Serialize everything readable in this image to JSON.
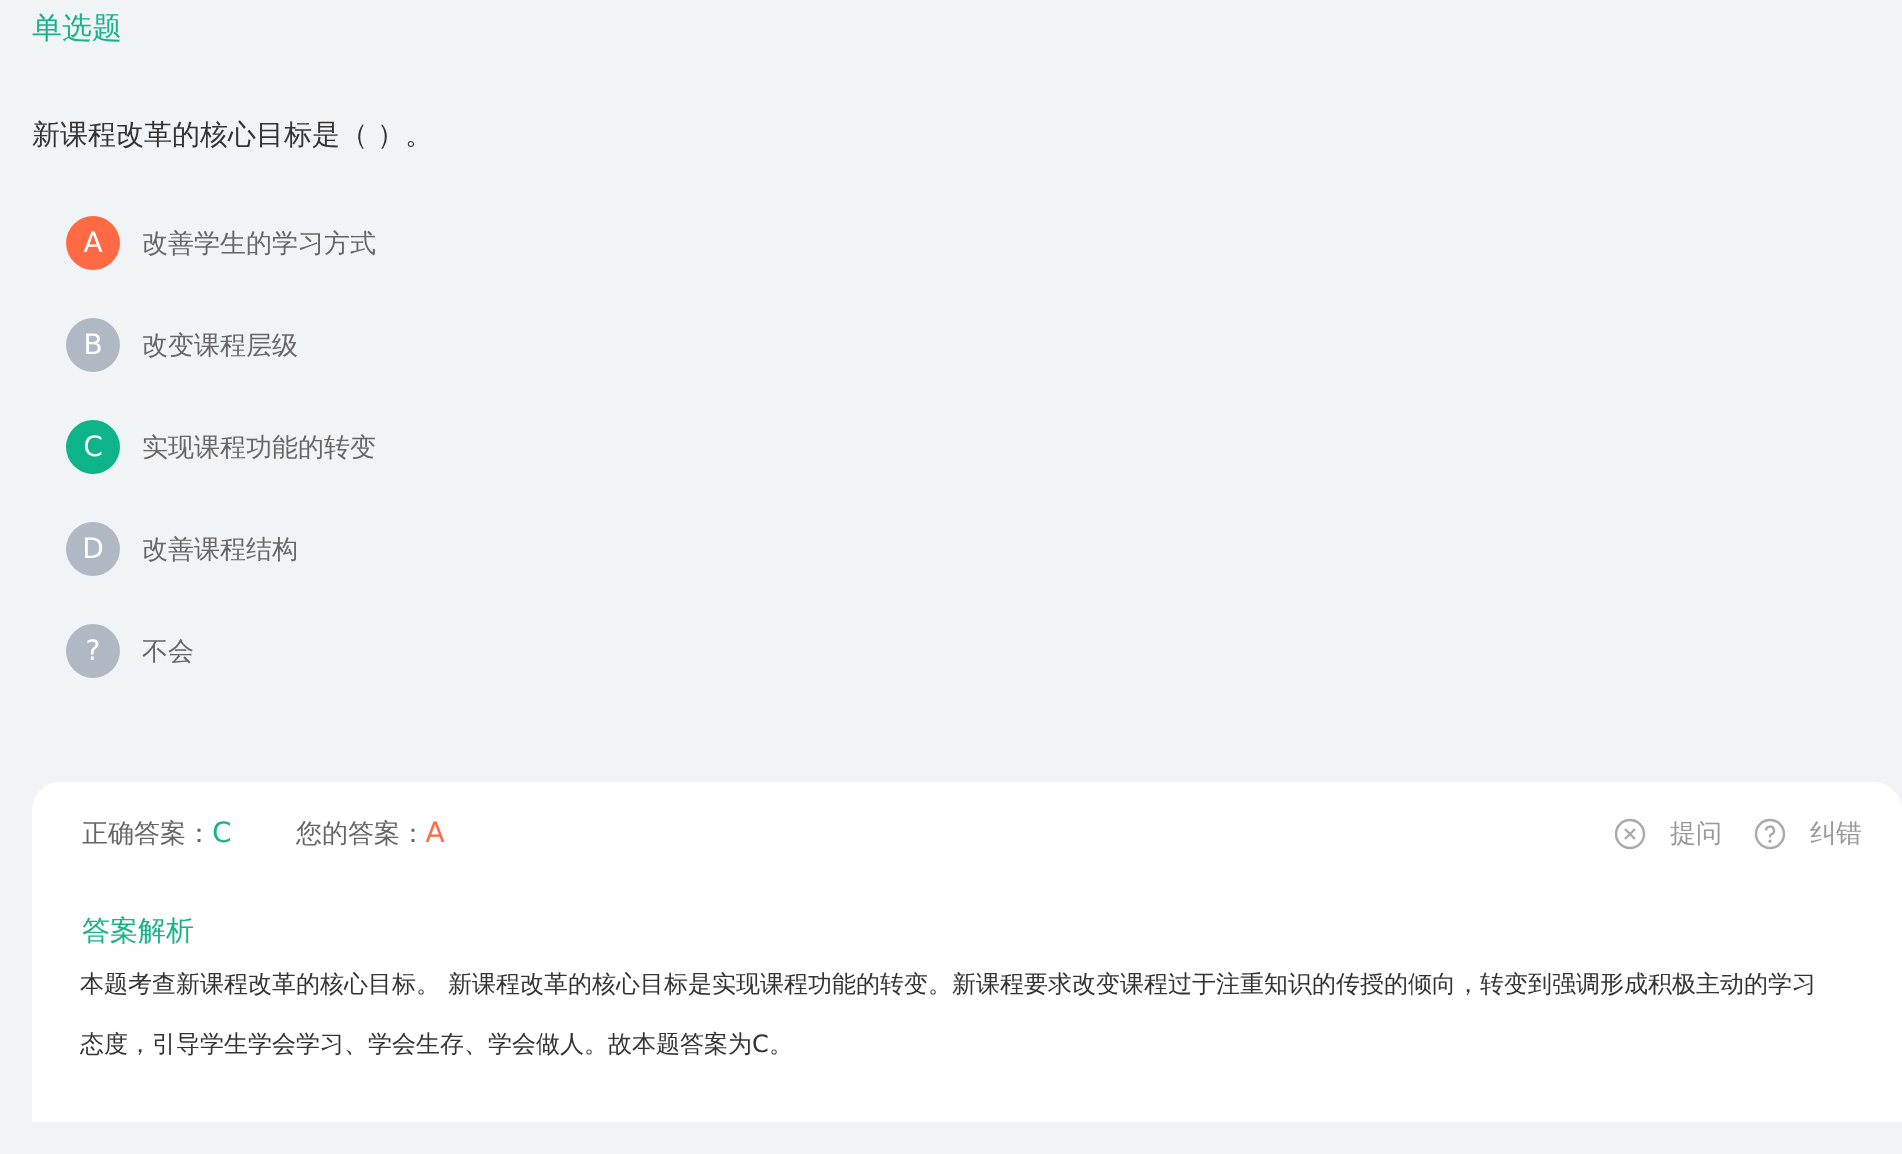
{
  "question_type": "单选题",
  "question": "新课程改革的核心目标是（   ）。",
  "options": [
    {
      "letter": "A",
      "text": "改善学生的学习方式",
      "selected": true,
      "correct": false
    },
    {
      "letter": "B",
      "text": "改变课程层级",
      "selected": false,
      "correct": false
    },
    {
      "letter": "C",
      "text": "实现课程功能的转变",
      "selected": false,
      "correct": true
    },
    {
      "letter": "D",
      "text": "改善课程结构",
      "selected": false,
      "correct": false
    },
    {
      "letter": "?",
      "text": "不会",
      "selected": false,
      "correct": false
    }
  ],
  "answer_card": {
    "correct_label": "正确答案：",
    "correct_value": "C",
    "yours_label": "您的答案：",
    "yours_value": "A",
    "actions": [
      {
        "kind": "ask",
        "label": "提问"
      },
      {
        "kind": "report",
        "label": "纠错"
      }
    ],
    "analysis_title": "答案解析",
    "analysis": "本题考查新课程改革的核心目标。 新课程改革的核心目标是实现课程功能的转变。新课程要求改变课程过于注重知识的传授的倾向，转变到强调形成积极主动的学习态度，引导学生学会学习、学会生存、学会做人。故本题答案为C。"
  }
}
